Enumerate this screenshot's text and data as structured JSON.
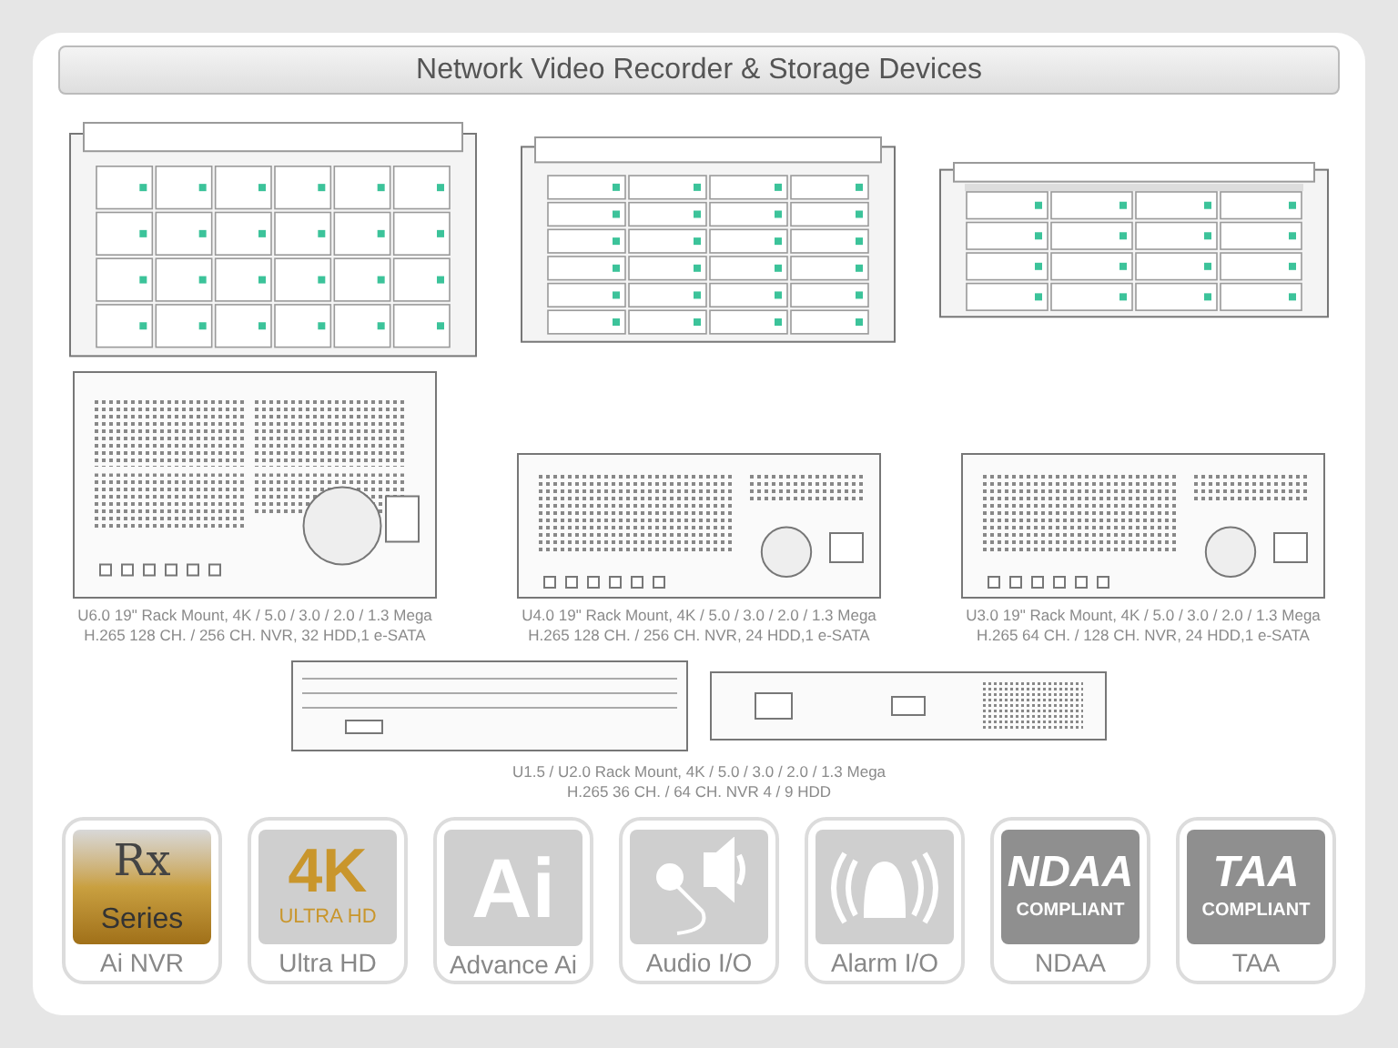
{
  "title": "Network Video Recorder & Storage Devices",
  "front_views": [
    {
      "kind": "rack4u"
    },
    {
      "kind": "rack3u"
    },
    {
      "kind": "rack2u"
    }
  ],
  "models": [
    {
      "kind": "back6",
      "lines": [
        "U6.0 19\" Rack Mount, 4K / 5.0 / 3.0 / 2.0 / 1.3 Mega",
        "H.265 128 CH. / 256 CH.  NVR, 32 HDD,1 e-SATA"
      ]
    },
    {
      "kind": "back4",
      "lines": [
        "U4.0 19\" Rack Mount, 4K / 5.0 / 3.0 / 2.0 / 1.3 Mega",
        "H.265 128 CH. / 256 CH.  NVR, 24 HDD,1 e-SATA"
      ]
    },
    {
      "kind": "back3",
      "lines": [
        "U3.0 19\" Rack Mount, 4K / 5.0 / 3.0 / 2.0 / 1.3 Mega",
        "H.265 64 CH. / 128 CH. NVR, 24 HDD,1 e-SATA"
      ]
    }
  ],
  "small_models": {
    "lines": [
      "U1.5 / U2.0 Rack Mount, 4K / 5.0 / 3.0 / 2.0 / 1.3 Mega",
      "H.265 36 CH. / 64 CH.  NVR 4 / 9 HDD"
    ]
  },
  "features": [
    {
      "kind": "rx",
      "logo": [
        "Rx",
        "Series"
      ],
      "label": "Ai NVR"
    },
    {
      "kind": "uhd",
      "logo": [
        "4K",
        "ULTRA HD"
      ],
      "label": "Ultra HD"
    },
    {
      "kind": "ai",
      "logo": [
        "Ai"
      ],
      "label": "Advance Ai"
    },
    {
      "kind": "audio",
      "label": "Audio I/O"
    },
    {
      "kind": "alarm",
      "label": "Alarm I/O"
    },
    {
      "kind": "stamp",
      "logo": [
        "NDAA",
        "COMPLIANT"
      ],
      "label": "NDAA"
    },
    {
      "kind": "stamp",
      "logo": [
        "TAA",
        "COMPLIANT"
      ],
      "label": "TAA"
    }
  ]
}
